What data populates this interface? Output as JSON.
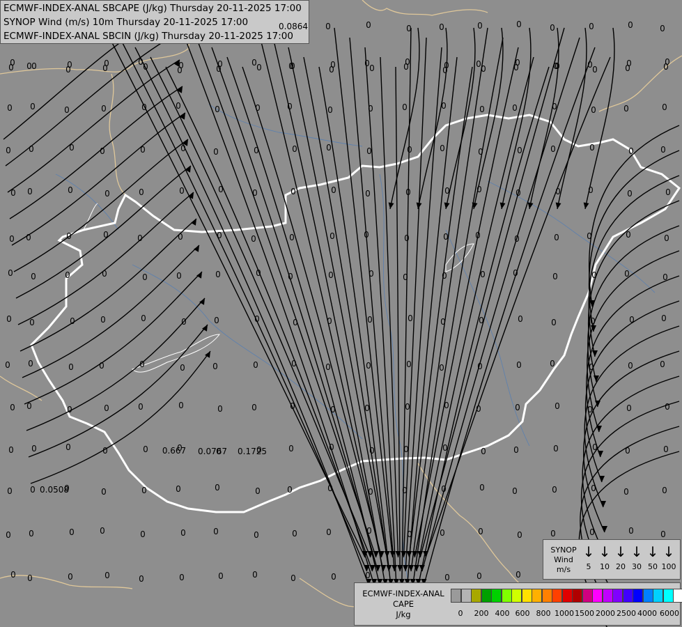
{
  "header": {
    "line1": "ECMWF-INDEX-ANAL SBCAPE (J/kg) Thursday 20-11-2025 17:00",
    "line2": "SYNOP Wind (m/s) 10m Thursday 20-11-2025 17:00",
    "line3": "ECMWF-INDEX-ANAL SBCIN (J/kg) Thursday 20-11-2025 17:00"
  },
  "colors": {
    "background": "#8e8e8e",
    "country_border": "#ffffff",
    "neighbour_border": "#e0c89a",
    "rivers": "#5a7fb0",
    "streamlines": "#000000"
  },
  "grid_values": {
    "zero_label": "0",
    "special": [
      "0.0864",
      "0.667",
      "0.0767",
      "0.1725",
      "0.0508"
    ]
  },
  "wind_legend": {
    "title": "SYNOP",
    "subtitle": "Wind",
    "unit": "m/s",
    "speeds": [
      "5",
      "10",
      "20",
      "30",
      "50",
      "100"
    ],
    "arrow_icon": "↓"
  },
  "cape_legend": {
    "title": "ECMWF-INDEX-ANAL",
    "subtitle": "CAPE",
    "unit": "J/kg",
    "ticks": [
      "0",
      "200",
      "400",
      "600",
      "800",
      "1000",
      "1500",
      "2000",
      "2500",
      "4000",
      "6000"
    ],
    "colors": [
      "#9a9a9a",
      "#b4b4b4",
      "#a8a800",
      "#00a000",
      "#00d000",
      "#80ff00",
      "#d0ff00",
      "#ffe000",
      "#ffb000",
      "#ff8000",
      "#ff4000",
      "#e00000",
      "#b00000",
      "#d00080",
      "#ff00ff",
      "#c000ff",
      "#8000ff",
      "#4000ff",
      "#0000ff",
      "#0080ff",
      "#00d0ff",
      "#00ffff",
      "#ffffff"
    ]
  }
}
